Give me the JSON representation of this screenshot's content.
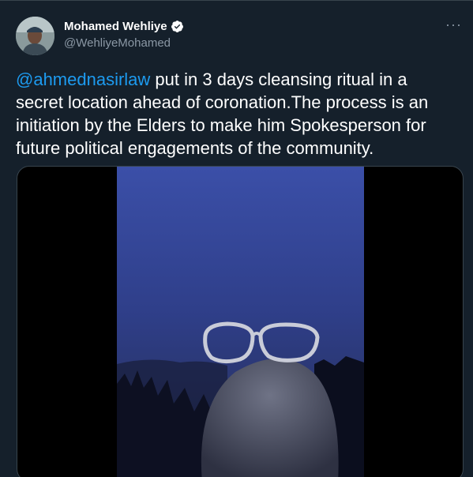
{
  "author": {
    "display_name": "Mohamed Wehliye",
    "handle": "@WehliyeMohamed",
    "verified": true
  },
  "menu": {
    "more_icon": "more-dots-icon",
    "more_glyph": "···"
  },
  "tweet": {
    "mention": "@ahmednasirlaw",
    "text_after_mention": " put in 3 days cleansing ritual in a secret location ahead of coronation.The process is an initiation by the Elders to make him Spokesperson for future political engagements of the community."
  },
  "media": {
    "type": "video",
    "icon": "video-thumbnail"
  },
  "colors": {
    "background": "#15202b",
    "text": "#ffffff",
    "secondary_text": "#8b98a5",
    "link": "#1d9bf0",
    "verified_badge": "#ffffff",
    "border": "#38444d"
  }
}
